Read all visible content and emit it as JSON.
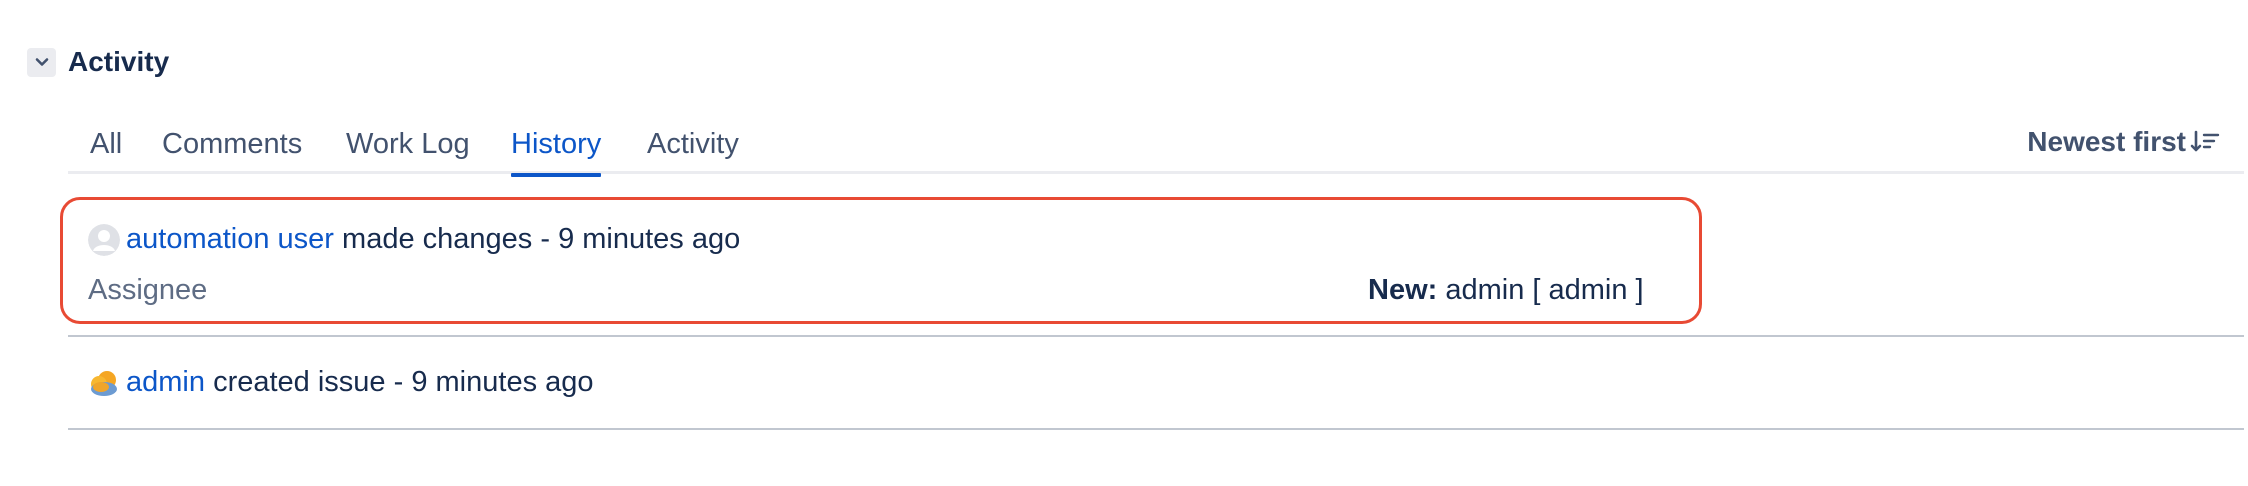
{
  "section": {
    "title": "Activity",
    "toggle_icon": "chevron-down-icon"
  },
  "tabs": [
    {
      "label": "All",
      "active": false
    },
    {
      "label": "Comments",
      "active": false
    },
    {
      "label": "Work Log",
      "active": false
    },
    {
      "label": "History",
      "active": true
    },
    {
      "label": "Activity",
      "active": false
    }
  ],
  "sort": {
    "label": "Newest first",
    "icon": "sort-descending-icon"
  },
  "history": [
    {
      "user": "automation user",
      "action": "made changes",
      "separator": " - ",
      "time": "9 minutes ago",
      "avatar": "default-user-avatar-icon",
      "field": "Assignee",
      "new_label": "New:",
      "new_value": "admin [ admin ]"
    },
    {
      "user": "admin",
      "action": "created issue",
      "separator": " - ",
      "time": "9 minutes ago",
      "avatar": "cloud-avatar-icon"
    }
  ],
  "colors": {
    "accent": "#0c56c8",
    "highlight_border": "#e84a34",
    "text": "#172b4d",
    "muted": "#42526e"
  }
}
